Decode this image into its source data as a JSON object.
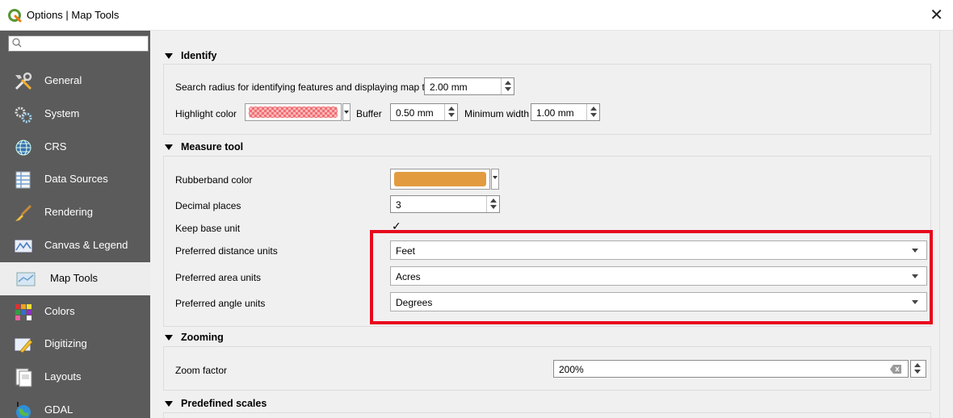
{
  "window": {
    "title": "Options | Map Tools"
  },
  "search": {
    "placeholder": ""
  },
  "sidebar": {
    "items": [
      {
        "label": "General",
        "icon": "tools-icon"
      },
      {
        "label": "System",
        "icon": "gears-icon"
      },
      {
        "label": "CRS",
        "icon": "globe-icon"
      },
      {
        "label": "Data Sources",
        "icon": "table-icon"
      },
      {
        "label": "Rendering",
        "icon": "brush-icon"
      },
      {
        "label": "Canvas & Legend",
        "icon": "map-canvas-icon"
      },
      {
        "label": "Map Tools",
        "icon": "map-tools-icon"
      },
      {
        "label": "Colors",
        "icon": "color-grid-icon"
      },
      {
        "label": "Digitizing",
        "icon": "digitizing-icon"
      },
      {
        "label": "Layouts",
        "icon": "layouts-icon"
      },
      {
        "label": "GDAL",
        "icon": "gdal-globe-icon"
      }
    ],
    "active_index": 6
  },
  "identify": {
    "title": "Identify",
    "search_radius_label": "Search radius for identifying features and displaying map tips",
    "search_radius_value": "2.00 mm",
    "highlight_color_label": "Highlight color",
    "highlight_color": "#f06f74",
    "buffer_label": "Buffer",
    "buffer_value": "0.50 mm",
    "min_width_label": "Minimum width",
    "min_width_value": "1.00 mm"
  },
  "measure": {
    "title": "Measure tool",
    "rubberband_label": "Rubberband color",
    "rubberband_color": "#e29c3f",
    "decimal_label": "Decimal places",
    "decimal_value": "3",
    "keep_base_label": "Keep base unit",
    "keep_base_checked": true,
    "distance_label": "Preferred distance units",
    "distance_value": "Feet",
    "area_label": "Preferred area units",
    "area_value": "Acres",
    "angle_label": "Preferred angle units",
    "angle_value": "Degrees"
  },
  "zooming": {
    "title": "Zooming",
    "zoom_factor_label": "Zoom factor",
    "zoom_factor_value": "200%"
  },
  "scales": {
    "title": "Predefined scales"
  },
  "colors": {
    "highlight_box": "#e8091d",
    "sidebar_bg": "#5b5b5b"
  }
}
